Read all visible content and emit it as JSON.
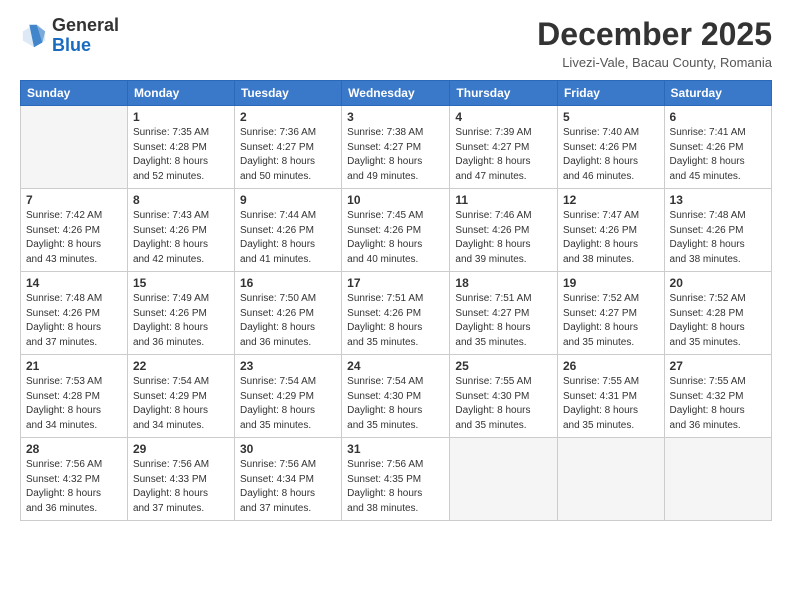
{
  "header": {
    "logo_general": "General",
    "logo_blue": "Blue",
    "month_title": "December 2025",
    "location": "Livezi-Vale, Bacau County, Romania"
  },
  "calendar": {
    "headers": [
      "Sunday",
      "Monday",
      "Tuesday",
      "Wednesday",
      "Thursday",
      "Friday",
      "Saturday"
    ],
    "weeks": [
      [
        {
          "day": "",
          "info": ""
        },
        {
          "day": "1",
          "info": "Sunrise: 7:35 AM\nSunset: 4:28 PM\nDaylight: 8 hours\nand 52 minutes."
        },
        {
          "day": "2",
          "info": "Sunrise: 7:36 AM\nSunset: 4:27 PM\nDaylight: 8 hours\nand 50 minutes."
        },
        {
          "day": "3",
          "info": "Sunrise: 7:38 AM\nSunset: 4:27 PM\nDaylight: 8 hours\nand 49 minutes."
        },
        {
          "day": "4",
          "info": "Sunrise: 7:39 AM\nSunset: 4:27 PM\nDaylight: 8 hours\nand 47 minutes."
        },
        {
          "day": "5",
          "info": "Sunrise: 7:40 AM\nSunset: 4:26 PM\nDaylight: 8 hours\nand 46 minutes."
        },
        {
          "day": "6",
          "info": "Sunrise: 7:41 AM\nSunset: 4:26 PM\nDaylight: 8 hours\nand 45 minutes."
        }
      ],
      [
        {
          "day": "7",
          "info": "Sunrise: 7:42 AM\nSunset: 4:26 PM\nDaylight: 8 hours\nand 43 minutes."
        },
        {
          "day": "8",
          "info": "Sunrise: 7:43 AM\nSunset: 4:26 PM\nDaylight: 8 hours\nand 42 minutes."
        },
        {
          "day": "9",
          "info": "Sunrise: 7:44 AM\nSunset: 4:26 PM\nDaylight: 8 hours\nand 41 minutes."
        },
        {
          "day": "10",
          "info": "Sunrise: 7:45 AM\nSunset: 4:26 PM\nDaylight: 8 hours\nand 40 minutes."
        },
        {
          "day": "11",
          "info": "Sunrise: 7:46 AM\nSunset: 4:26 PM\nDaylight: 8 hours\nand 39 minutes."
        },
        {
          "day": "12",
          "info": "Sunrise: 7:47 AM\nSunset: 4:26 PM\nDaylight: 8 hours\nand 38 minutes."
        },
        {
          "day": "13",
          "info": "Sunrise: 7:48 AM\nSunset: 4:26 PM\nDaylight: 8 hours\nand 38 minutes."
        }
      ],
      [
        {
          "day": "14",
          "info": "Sunrise: 7:48 AM\nSunset: 4:26 PM\nDaylight: 8 hours\nand 37 minutes."
        },
        {
          "day": "15",
          "info": "Sunrise: 7:49 AM\nSunset: 4:26 PM\nDaylight: 8 hours\nand 36 minutes."
        },
        {
          "day": "16",
          "info": "Sunrise: 7:50 AM\nSunset: 4:26 PM\nDaylight: 8 hours\nand 36 minutes."
        },
        {
          "day": "17",
          "info": "Sunrise: 7:51 AM\nSunset: 4:26 PM\nDaylight: 8 hours\nand 35 minutes."
        },
        {
          "day": "18",
          "info": "Sunrise: 7:51 AM\nSunset: 4:27 PM\nDaylight: 8 hours\nand 35 minutes."
        },
        {
          "day": "19",
          "info": "Sunrise: 7:52 AM\nSunset: 4:27 PM\nDaylight: 8 hours\nand 35 minutes."
        },
        {
          "day": "20",
          "info": "Sunrise: 7:52 AM\nSunset: 4:28 PM\nDaylight: 8 hours\nand 35 minutes."
        }
      ],
      [
        {
          "day": "21",
          "info": "Sunrise: 7:53 AM\nSunset: 4:28 PM\nDaylight: 8 hours\nand 34 minutes."
        },
        {
          "day": "22",
          "info": "Sunrise: 7:54 AM\nSunset: 4:29 PM\nDaylight: 8 hours\nand 34 minutes."
        },
        {
          "day": "23",
          "info": "Sunrise: 7:54 AM\nSunset: 4:29 PM\nDaylight: 8 hours\nand 35 minutes."
        },
        {
          "day": "24",
          "info": "Sunrise: 7:54 AM\nSunset: 4:30 PM\nDaylight: 8 hours\nand 35 minutes."
        },
        {
          "day": "25",
          "info": "Sunrise: 7:55 AM\nSunset: 4:30 PM\nDaylight: 8 hours\nand 35 minutes."
        },
        {
          "day": "26",
          "info": "Sunrise: 7:55 AM\nSunset: 4:31 PM\nDaylight: 8 hours\nand 35 minutes."
        },
        {
          "day": "27",
          "info": "Sunrise: 7:55 AM\nSunset: 4:32 PM\nDaylight: 8 hours\nand 36 minutes."
        }
      ],
      [
        {
          "day": "28",
          "info": "Sunrise: 7:56 AM\nSunset: 4:32 PM\nDaylight: 8 hours\nand 36 minutes."
        },
        {
          "day": "29",
          "info": "Sunrise: 7:56 AM\nSunset: 4:33 PM\nDaylight: 8 hours\nand 37 minutes."
        },
        {
          "day": "30",
          "info": "Sunrise: 7:56 AM\nSunset: 4:34 PM\nDaylight: 8 hours\nand 37 minutes."
        },
        {
          "day": "31",
          "info": "Sunrise: 7:56 AM\nSunset: 4:35 PM\nDaylight: 8 hours\nand 38 minutes."
        },
        {
          "day": "",
          "info": ""
        },
        {
          "day": "",
          "info": ""
        },
        {
          "day": "",
          "info": ""
        }
      ]
    ]
  }
}
